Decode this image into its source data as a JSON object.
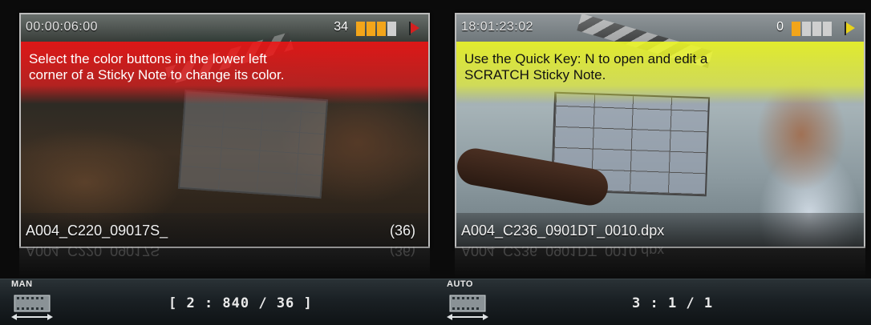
{
  "panels": [
    {
      "timecode": "00:00:06:00",
      "count": "34",
      "level_bars_filled": 3,
      "level_bars_total": 4,
      "note_color": "#e61414",
      "note_lines": [
        "Select the color buttons in the lower left",
        "corner of a Sticky Note to change its color."
      ],
      "clip_name": "A004_C220_09017S_",
      "frame_count": "(36)",
      "reflection_name": "A004_C220_09017S",
      "reflection_count": "(36)",
      "mode": "MAN",
      "ratio": "[ 2 : 840 / 36 ]",
      "icons": {
        "flag": "red-flag-icon",
        "film": "film-strip-icon"
      }
    },
    {
      "timecode": "18:01:23:02",
      "count": "0",
      "level_bars_filled": 1,
      "level_bars_total": 4,
      "note_color": "#e6f028",
      "note_lines": [
        "Use the Quick Key: N to open and edit a",
        "SCRATCH Sticky Note."
      ],
      "clip_name": "A004_C236_0901DT_0010.dpx",
      "frame_count": "",
      "reflection_name": "A004_C236_0901DT_0010.dpx",
      "reflection_count": "",
      "mode": "AUTO",
      "ratio": "3 : 1 / 1",
      "icons": {
        "flag": "yellow-flag-icon",
        "film": "film-strip-icon"
      }
    }
  ],
  "colors": {
    "level_on": "#f3a51a",
    "level_off": "#cfcfcf"
  }
}
